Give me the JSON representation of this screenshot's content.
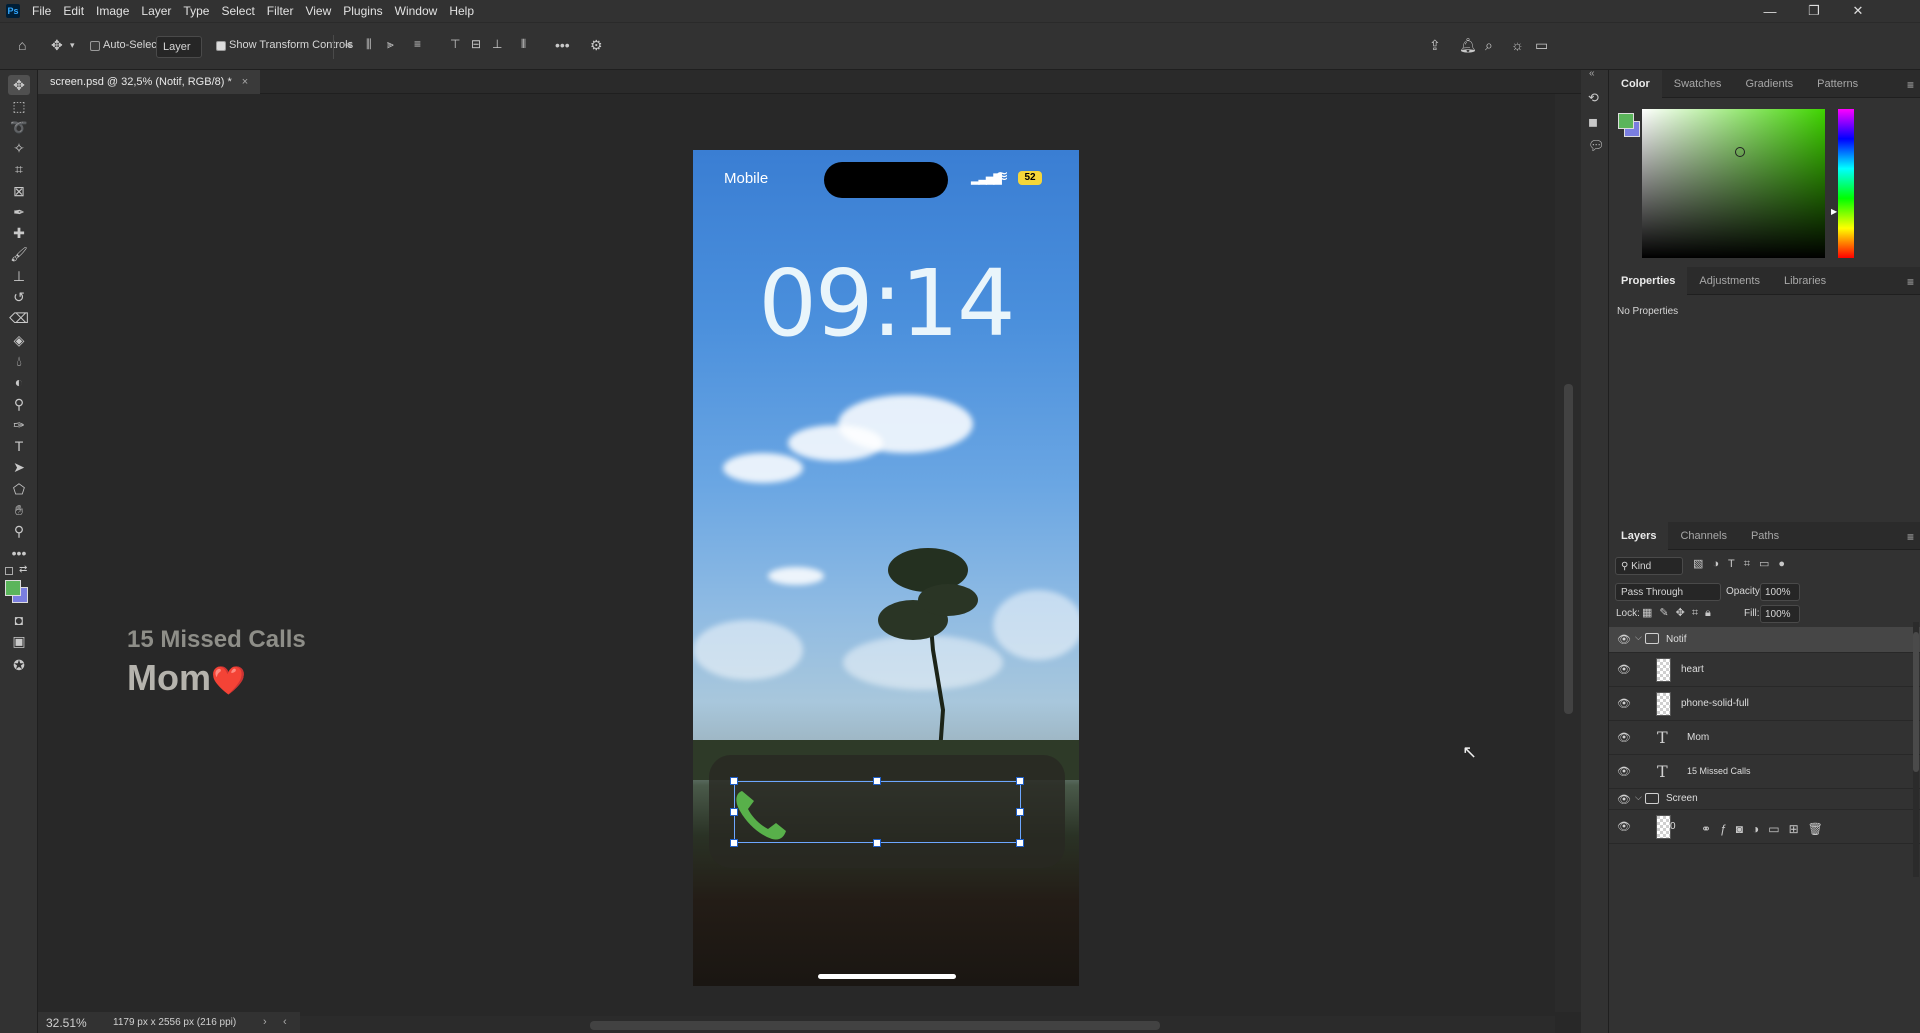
{
  "app": {
    "logo": "Ps",
    "menu": [
      "File",
      "Edit",
      "Image",
      "Layer",
      "Type",
      "Select",
      "Filter",
      "View",
      "Plugins",
      "Window",
      "Help"
    ],
    "window_controls": {
      "minimize": "—",
      "restore": "❐",
      "close": "✕"
    }
  },
  "options": {
    "auto_select_label": "Auto-Select:",
    "auto_select_checked": false,
    "target_value": "Layer",
    "show_transform_label": "Show Transform Controls",
    "show_transform_checked": true
  },
  "document": {
    "tab_title": "screen.psd @ 32,5% (Notif, RGB/8) *",
    "zoom": "32.51%",
    "doc_info": "1179 px x 2556 px (216 ppi)"
  },
  "phone": {
    "carrier": "Mobile",
    "battery": "52",
    "time": "09:14",
    "notification_title": "15 Missed Calls",
    "notification_body": "Mom",
    "notification_emoji": "❤️",
    "phone_icon": "phone-solid-full"
  },
  "color_panel": {
    "tabs": [
      "Color",
      "Swatches",
      "Gradients",
      "Patterns"
    ],
    "active_tab": "Color",
    "foreground": "#5bb55b",
    "background": "#7a7ee0",
    "field_hue": "#3fd400"
  },
  "properties_panel": {
    "tabs": [
      "Properties",
      "Adjustments",
      "Libraries"
    ],
    "active_tab": "Properties",
    "empty_text": "No Properties"
  },
  "layers_panel": {
    "tabs": [
      "Layers",
      "Channels",
      "Paths"
    ],
    "active_tab": "Layers",
    "filter_kind": "Kind",
    "blend_mode": "Pass Through",
    "opacity_label": "Opacity:",
    "opacity": "100%",
    "lock_label": "Lock:",
    "fill_label": "Fill:",
    "fill": "100%",
    "layers": [
      {
        "name": "Notif",
        "kind": "group",
        "selected": true
      },
      {
        "name": "heart",
        "kind": "pixel"
      },
      {
        "name": "phone-solid-full",
        "kind": "pixel"
      },
      {
        "name": "Mom",
        "kind": "text"
      },
      {
        "name": "15 Missed Calls",
        "kind": "text"
      },
      {
        "name": "Screen",
        "kind": "group"
      },
      {
        "name": "0",
        "kind": "pixel"
      }
    ]
  }
}
